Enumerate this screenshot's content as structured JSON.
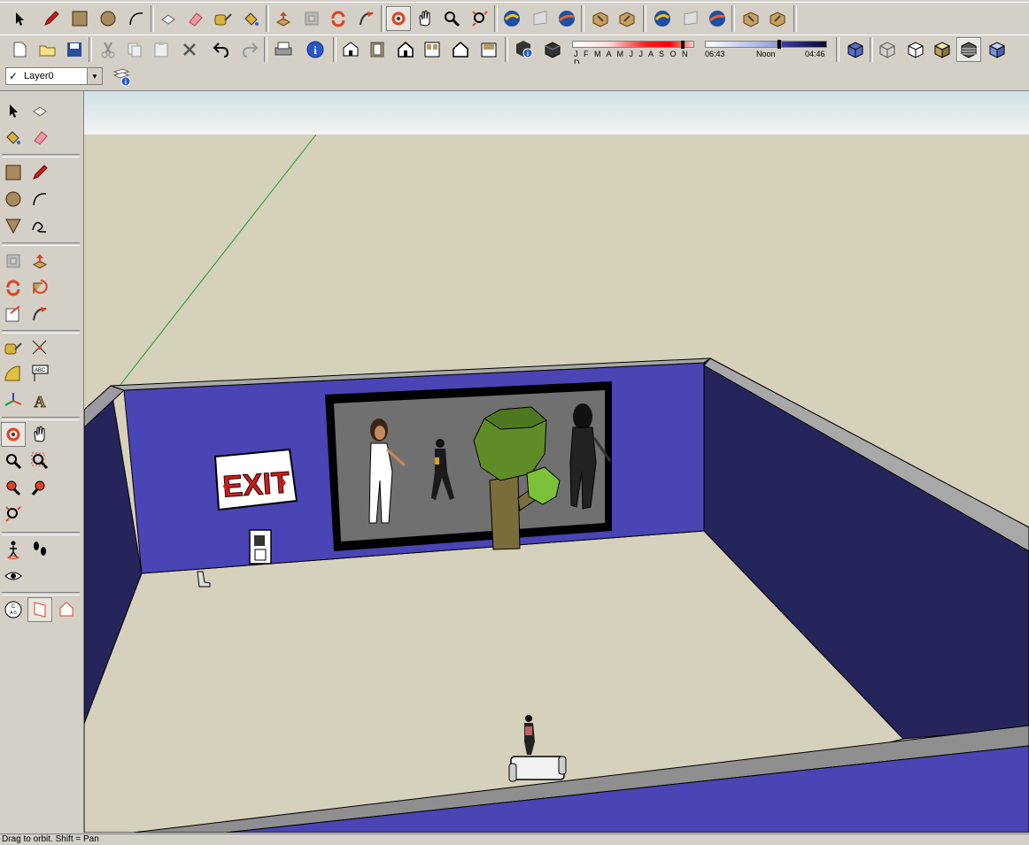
{
  "layer_toolbar": {
    "current_layer": "Layer0",
    "visible_check": "✓"
  },
  "shadow_settings": {
    "months": "J F M A M J J A S O N D",
    "sunrise": "06:43",
    "noon": "Noon",
    "sunset": "04:46",
    "date_position": 0.92
  },
  "exit_sign_text": "EXIT",
  "status_bar": {
    "text": "Drag to orbit. Shift = Pan"
  },
  "colors": {
    "wall_front": "#4a44b4",
    "wall_dark": "#25245b",
    "floor": "#d6d1bc",
    "sky": "#ecf0ee",
    "tree_green": "#5f8c26"
  },
  "icons": {
    "row1": [
      "select-icon",
      "pencil-icon",
      "rectangle-icon",
      "circle-icon",
      "arc-icon",
      "make-component-icon",
      "eraser-icon",
      "tape-measure-icon",
      "paint-bucket-icon",
      "push-pull-icon",
      "offset-icon",
      "rotate-icon",
      "follow-me-icon",
      "orbit-icon",
      "pan-icon",
      "zoom-icon",
      "zoom-extents-icon",
      "get-models-icon",
      "share-model-icon",
      "google-earth-icon",
      "component-download-icon",
      "component-share-icon"
    ],
    "row2": [
      "new-icon",
      "open-icon",
      "save-icon",
      "cut-icon",
      "copy-icon",
      "paste-icon",
      "erase-icon",
      "undo-icon",
      "redo-icon",
      "print-icon",
      "model-info-icon",
      "iso-view-icon",
      "top-view-icon",
      "front-view-icon",
      "right-view-icon",
      "back-view-icon",
      "left-view-icon",
      "shadow-settings-icon",
      "display-shadows-icon",
      "xray-icon",
      "wireframe-icon",
      "hidden-line-icon",
      "shaded-icon",
      "shaded-textures-icon",
      "monochrome-icon"
    ]
  }
}
